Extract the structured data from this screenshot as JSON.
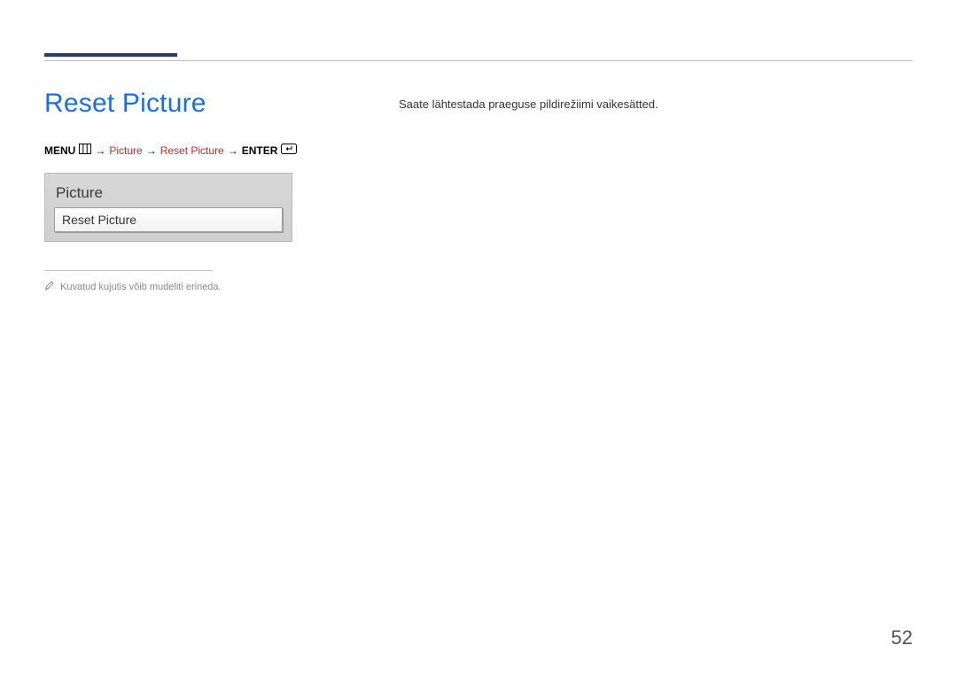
{
  "header": {
    "title": "Reset Picture"
  },
  "breadcrumb": {
    "menu_label": "MENU",
    "arrow": "→",
    "picture": "Picture",
    "reset_picture": "Reset Picture",
    "enter_label": "ENTER"
  },
  "menu_panel": {
    "header": "Picture",
    "selected_item": "Reset Picture"
  },
  "footnote": {
    "text": "Kuvatud kujutis võib mudeliti erineda."
  },
  "description": {
    "text": "Saate lähtestada praeguse pildirežiimi vaikesätted."
  },
  "page_number": "52"
}
